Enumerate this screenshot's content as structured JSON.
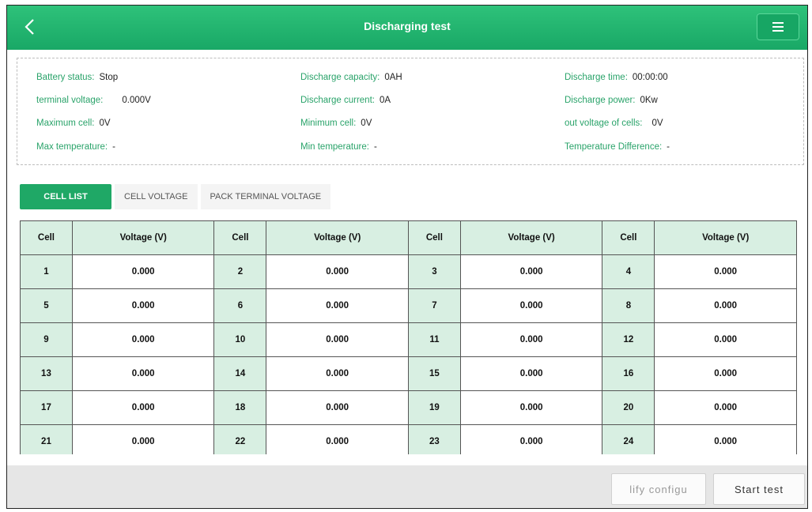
{
  "header": {
    "title": "Discharging test",
    "back_icon": "chevron-left-icon",
    "menu_icon": "hamburger-menu-icon"
  },
  "info": {
    "battery_status": {
      "label": "Battery status:",
      "value": "Stop"
    },
    "discharge_capacity": {
      "label": "Discharge capacity:",
      "value": "0AH"
    },
    "discharge_time": {
      "label": "Discharge time:",
      "value": "00:00:00"
    },
    "terminal_voltage": {
      "label": "terminal voltage:",
      "value": "0.000V"
    },
    "discharge_current": {
      "label": "Discharge current:",
      "value": "0A"
    },
    "discharge_power": {
      "label": "Discharge power:",
      "value": "0Kw"
    },
    "maximum_cell": {
      "label": "Maximum cell:",
      "value": "0V"
    },
    "minimum_cell": {
      "label": "Minimum cell:",
      "value": "0V"
    },
    "out_voltage": {
      "label": "out voltage of cells:",
      "value": "0V"
    },
    "max_temperature": {
      "label": "Max temperature:",
      "value": "-"
    },
    "min_temperature": {
      "label": "Min temperature:",
      "value": "-"
    },
    "temperature_difference": {
      "label": "Temperature Difference:",
      "value": "-"
    }
  },
  "tabs": [
    "CELL LIST",
    "CELL VOLTAGE",
    "PACK TERMINAL VOLTAGE"
  ],
  "table": {
    "headers": [
      "Cell",
      "Voltage (V)",
      "Cell",
      "Voltage (V)",
      "Cell",
      "Voltage (V)",
      "Cell",
      "Voltage (V)"
    ],
    "rows": [
      [
        "1",
        "0.000",
        "2",
        "0.000",
        "3",
        "0.000",
        "4",
        "0.000"
      ],
      [
        "5",
        "0.000",
        "6",
        "0.000",
        "7",
        "0.000",
        "8",
        "0.000"
      ],
      [
        "9",
        "0.000",
        "10",
        "0.000",
        "11",
        "0.000",
        "12",
        "0.000"
      ],
      [
        "13",
        "0.000",
        "14",
        "0.000",
        "15",
        "0.000",
        "16",
        "0.000"
      ],
      [
        "17",
        "0.000",
        "18",
        "0.000",
        "19",
        "0.000",
        "20",
        "0.000"
      ],
      [
        "21",
        "0.000",
        "22",
        "0.000",
        "23",
        "0.000",
        "24",
        "0.000"
      ]
    ]
  },
  "footer": {
    "modify_config": "lify configu",
    "start_test": "Start test"
  },
  "colors": {
    "accent": "#1fa866",
    "label": "#2aa36a",
    "cell_bg": "#d8efe2",
    "footer_bg": "#e6e6e6"
  }
}
